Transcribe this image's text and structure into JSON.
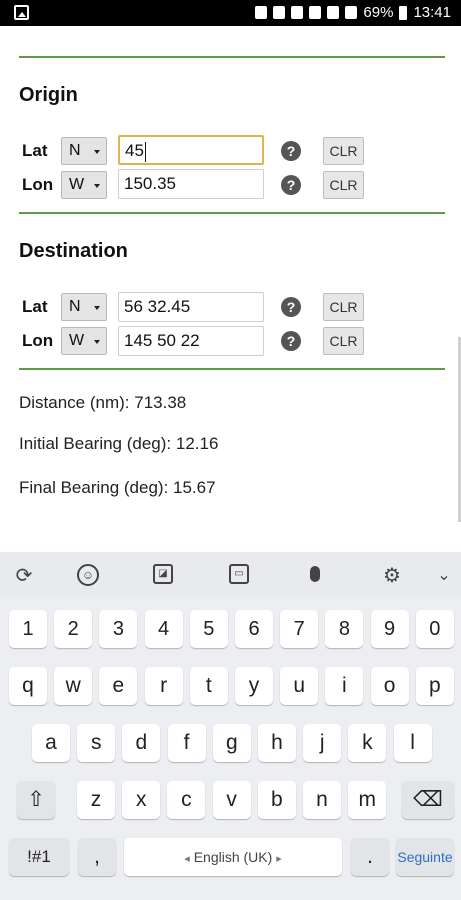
{
  "status": {
    "battery_pct": "69%",
    "time": "13:41"
  },
  "origin": {
    "title": "Origin",
    "lat": {
      "label": "Lat",
      "dir": "N",
      "value": "45"
    },
    "lon": {
      "label": "Lon",
      "dir": "W",
      "value": "150.35"
    }
  },
  "destination": {
    "title": "Destination",
    "lat": {
      "label": "Lat",
      "dir": "N",
      "value": "56 32.45"
    },
    "lon": {
      "label": "Lon",
      "dir": "W",
      "value": "145 50 22"
    }
  },
  "help_glyph": "?",
  "clr_label": "CLR",
  "results": {
    "distance": "Distance (nm): 713.38",
    "initial_bearing": "Initial Bearing (deg): 12.16",
    "final_bearing": "Final Bearing (deg): 15.67"
  },
  "keyboard": {
    "digits": [
      "1",
      "2",
      "3",
      "4",
      "5",
      "6",
      "7",
      "8",
      "9",
      "0"
    ],
    "row1": [
      "q",
      "w",
      "e",
      "r",
      "t",
      "y",
      "u",
      "i",
      "o",
      "p"
    ],
    "row2": [
      "a",
      "s",
      "d",
      "f",
      "g",
      "h",
      "j",
      "k",
      "l"
    ],
    "row3": [
      "z",
      "x",
      "c",
      "v",
      "b",
      "n",
      "m"
    ],
    "symbols_label": "!#1",
    "comma": ",",
    "space_label": "English (UK)",
    "period": ".",
    "action_label": "Seguinte",
    "icons": [
      "translate-icon",
      "emoji-icon",
      "sticker-icon",
      "gif-icon",
      "microphone-icon",
      "settings-icon",
      "collapse-icon",
      "shift-icon",
      "backspace-icon"
    ]
  },
  "colors": {
    "rule_green": "#5c9a4c",
    "focus_border": "#e4b347",
    "action_blue": "#2f6fc0"
  }
}
